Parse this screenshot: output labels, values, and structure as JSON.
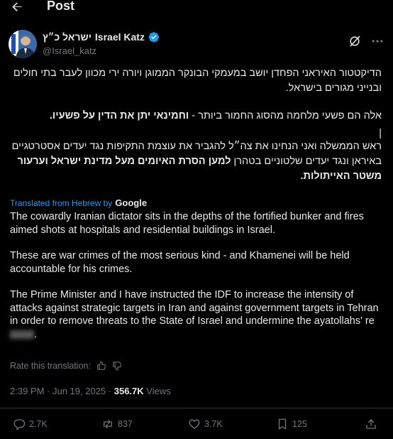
{
  "topbar": {
    "back_icon": "arrow-left-icon",
    "title": "Post"
  },
  "author": {
    "name_hebrew": "ישראל כ״ץ",
    "name": "Israel Katz",
    "handle": "@Israel_katz",
    "verified": true
  },
  "hebrew": {
    "p1": "הדיקטטור האיראני הפחדן יושב במעמקי הבונקר הממוגן ויורה ירי מכוון לעבר בתי חולים ובנייני מגורים בישראל.",
    "p2_plain": "אלה הם פשעי מלחמה מהסוג החמור ביותר - ",
    "p2_bold": "וחמינאי יתן את הדין על פשעיו.",
    "p3_plain": "ראש הממשלה ואני הנחינו את צה״ל להגביר את עוצמת התקיפות נגד יעדים אסטרטגיים באיראן ונגד יעדים שלטוניים בטהרן ",
    "p3_bold": "למען הסרת האיומים מעל מדינת ישראל וערעור משטר האייתולות."
  },
  "translation": {
    "label": "Translated from Hebrew by",
    "provider": "Google",
    "p1": "The cowardly Iranian dictator sits in the depths of the fortified bunker and fires aimed shots at hospitals and residential buildings in Israel.",
    "p2": "These are war crimes of the most serious kind - and Khamenei will be held accountable for his crimes.",
    "p3": "The Prime Minister and I have instructed the IDF to increase the intensity of attacks against strategic targets in Iran and against government targets in Tehran in order to remove threats to the State of Israel and undermine the ayatollahs' re",
    "p3_tail": "."
  },
  "rate": {
    "label": "Rate this translation:"
  },
  "meta": {
    "time": "2:39 PM",
    "date": "Jun 19, 2025",
    "views": "356.7K",
    "views_label": "Views",
    "sep": " · "
  },
  "actions": {
    "replies": "2.7K",
    "reposts": "837",
    "likes": "3.7K",
    "bookmarks": "125"
  },
  "colors": {
    "accent": "#1d9bf0",
    "muted": "#71767b",
    "text": "#e7e9ea",
    "background": "#000000"
  }
}
